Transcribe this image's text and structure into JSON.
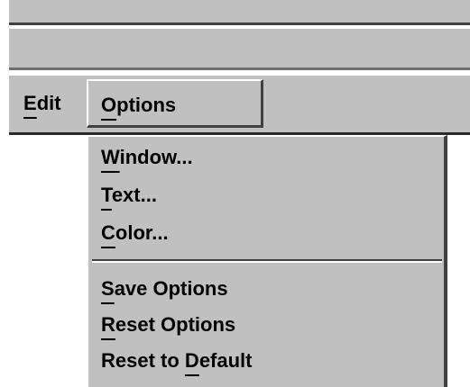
{
  "menubar": {
    "edit": {
      "pre": "",
      "mn": "E",
      "post": "dit"
    },
    "options": {
      "pre": "",
      "mn": "O",
      "post": "ptions"
    }
  },
  "options_menu": {
    "window": {
      "pre": "",
      "mn": "W",
      "post": "indow..."
    },
    "text": {
      "pre": "",
      "mn": "T",
      "post": "ext..."
    },
    "color": {
      "pre": "",
      "mn": "C",
      "post": "olor..."
    },
    "save_options": {
      "pre": "",
      "mn": "S",
      "post": "ave Options"
    },
    "reset_options": {
      "pre": "",
      "mn": "R",
      "post": "eset Options"
    },
    "reset_to_default": {
      "pre": "Reset to ",
      "mn": "D",
      "post": "efault"
    }
  }
}
